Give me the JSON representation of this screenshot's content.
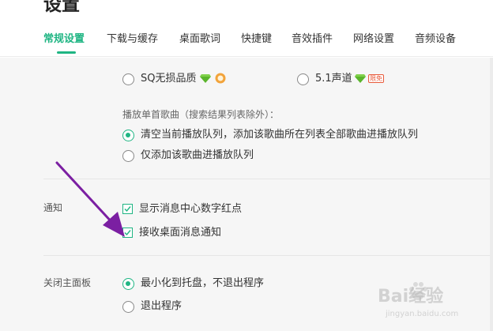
{
  "header": {
    "title": "设置",
    "tabs": [
      {
        "label": "常规设置",
        "active": true
      },
      {
        "label": "下载与缓存",
        "active": false
      },
      {
        "label": "桌面歌词",
        "active": false
      },
      {
        "label": "快捷键",
        "active": false
      },
      {
        "label": "音效插件",
        "active": false
      },
      {
        "label": "网络设置",
        "active": false
      },
      {
        "label": "音频设备",
        "active": false
      }
    ]
  },
  "quality": {
    "options": [
      {
        "label": "SQ无损品质",
        "selected": false
      },
      {
        "label": "5.1声道",
        "selected": false
      }
    ],
    "tag": "限免"
  },
  "play_single": {
    "label": "播放单首歌曲（搜索结果列表除外）：",
    "options": [
      {
        "label": "清空当前播放队列，添加该歌曲所在列表全部歌曲进播放队列",
        "selected": true
      },
      {
        "label": "仅添加该歌曲进播放队列",
        "selected": false
      }
    ]
  },
  "notify": {
    "label": "通知",
    "options": [
      {
        "label": "显示消息中心数字红点",
        "checked": true
      },
      {
        "label": "接收桌面消息通知",
        "checked": true
      }
    ]
  },
  "close_panel": {
    "label": "关闭主面板",
    "options": [
      {
        "label": "最小化到托盘，不退出程序",
        "selected": true
      },
      {
        "label": "退出程序",
        "selected": false
      }
    ]
  },
  "watermark": {
    "text": "Bai经验",
    "sub": "jingyan.baidu.com"
  },
  "colors": {
    "accent": "#1fb583",
    "arrow": "#7b1fa2"
  }
}
